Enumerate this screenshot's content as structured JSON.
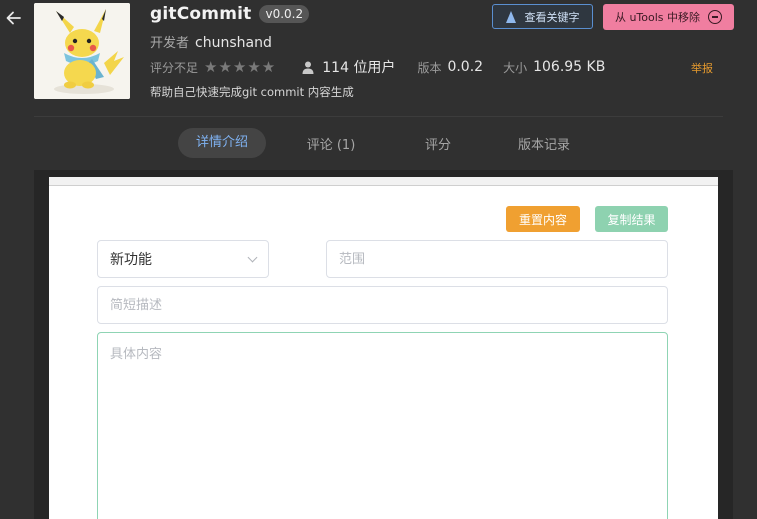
{
  "header": {
    "app_title": "gitCommit",
    "version_badge": "v0.0.2",
    "developer_label": "开发者",
    "developer_name": "chunshand",
    "rating_label": "评分不足",
    "stars": "★★★★★",
    "users": "114 位用户",
    "version_label": "版本",
    "version_value": "0.0.2",
    "size_label": "大小",
    "size_value": "106.95 KB",
    "description": "帮助自己快速完成git commit 内容生成",
    "keywords_button": "查看关键字",
    "remove_button": "从 uTools 中移除",
    "report_link": "举报"
  },
  "tabs": [
    {
      "label": "详情介绍",
      "active": true
    },
    {
      "label": "评论 (1)",
      "active": false
    },
    {
      "label": "评分",
      "active": false
    },
    {
      "label": "版本记录",
      "active": false
    }
  ],
  "form": {
    "reset_button": "重置内容",
    "copy_button": "复制结果",
    "type_select_value": "新功能",
    "scope_placeholder": "范围",
    "summary_placeholder": "简短描述",
    "body_placeholder": "具体内容"
  },
  "colors": {
    "background": "#303030",
    "accent_blue": "#7fb2f2",
    "remove_pink": "#f07ea0",
    "reset_orange": "#f0a031",
    "copy_green": "#8ed2b0",
    "report_orange": "#e59a2e"
  }
}
